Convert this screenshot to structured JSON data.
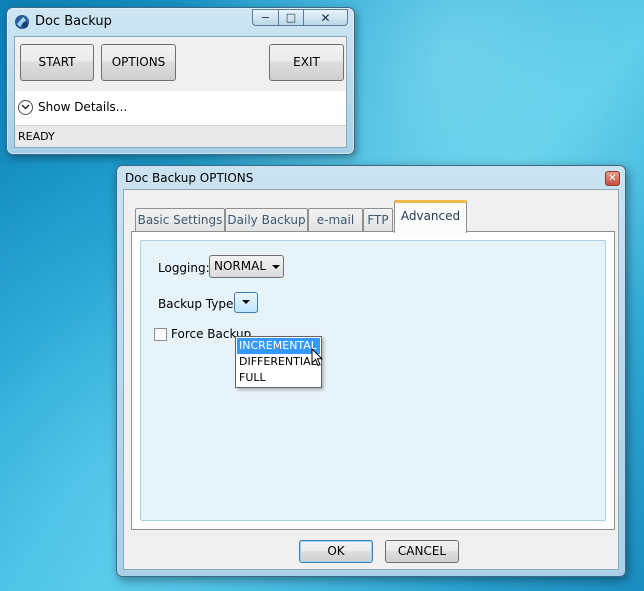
{
  "main_window": {
    "title": "Doc Backup",
    "caption_buttons": {
      "minimize": "−",
      "maximize": "□",
      "close": "✕"
    },
    "buttons": {
      "start": "START",
      "options": "OPTIONS",
      "exit": "EXIT"
    },
    "show_details": "Show Details...",
    "status": "READY"
  },
  "options_dialog": {
    "title": "Doc Backup OPTIONS",
    "close_glyph": "✕",
    "tabs": [
      "Basic Settings",
      "Daily Backup",
      "e-mail",
      "FTP",
      "Advanced"
    ],
    "active_tab": "Advanced",
    "logging_label": "Logging:",
    "logging_value": "NORMAL",
    "backup_type_label": "Backup Type:",
    "force_backup_label": "Force Backup",
    "backup_type_options": [
      "INCREMENTAL",
      "DIFFERENTIAL",
      "FULL"
    ],
    "highlighted_option": "INCREMENTAL",
    "ok": "OK",
    "cancel": "CANCEL"
  },
  "icons": [
    "app-icon",
    "expander-chevron-icon",
    "mouse-cursor-icon"
  ],
  "colors": {
    "desktop": "#2ea6d2",
    "active_tab_accent": "#f2ba4d",
    "selection": "#3399ff"
  }
}
